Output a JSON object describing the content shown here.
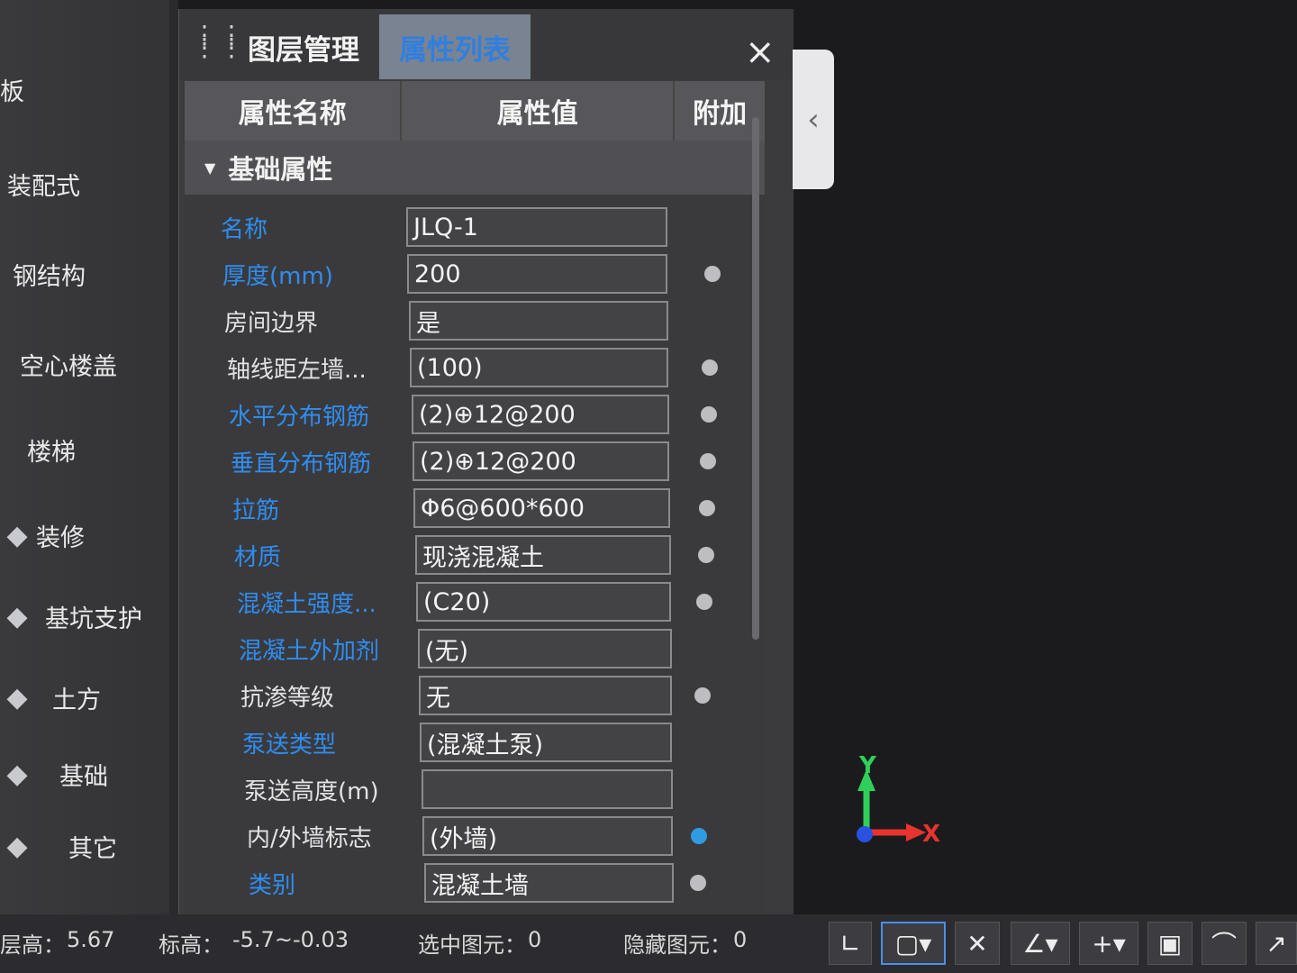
{
  "sidebar": {
    "items": [
      {
        "label": "板",
        "icon": "slab-icon"
      },
      {
        "label": "装配式",
        "icon": "prefab-icon"
      },
      {
        "label": "钢结构",
        "icon": "steel-icon"
      },
      {
        "label": "空心楼盖",
        "icon": "hollow-floor-icon"
      },
      {
        "label": "楼梯",
        "icon": "stairs-icon"
      },
      {
        "label": "装修",
        "icon": "decoration-icon"
      },
      {
        "label": "基坑支护",
        "icon": "pit-support-icon"
      },
      {
        "label": "土方",
        "icon": "earthwork-icon"
      },
      {
        "label": "基础",
        "icon": "foundation-icon"
      },
      {
        "label": "其它",
        "icon": "other-icon"
      }
    ]
  },
  "panel": {
    "tabs": [
      {
        "label": "图层管理",
        "active": false
      },
      {
        "label": "属性列表",
        "active": true
      }
    ],
    "close_label": "×",
    "columns": [
      "属性名称",
      "属性值",
      "附加"
    ],
    "group": {
      "label": "基础属性",
      "expanded": true
    },
    "rows": [
      {
        "name": "名称",
        "value": "JLQ-1",
        "blue": true,
        "dot": "none"
      },
      {
        "name": "厚度(mm)",
        "value": "200",
        "blue": true,
        "dot": "grey"
      },
      {
        "name": "房间边界",
        "value": "是",
        "blue": false,
        "dot": "none"
      },
      {
        "name": "轴线距左墙...",
        "value": "(100)",
        "blue": false,
        "dot": "grey"
      },
      {
        "name": "水平分布钢筋",
        "value": "(2)⊕12@200",
        "blue": true,
        "dot": "grey"
      },
      {
        "name": "垂直分布钢筋",
        "value": "(2)⊕12@200",
        "blue": true,
        "dot": "grey"
      },
      {
        "name": "拉筋",
        "value": "Φ6@600*600",
        "blue": true,
        "dot": "grey"
      },
      {
        "name": "材质",
        "value": "现浇混凝土",
        "blue": true,
        "dot": "grey"
      },
      {
        "name": "混凝土强度...",
        "value": "(C20)",
        "blue": true,
        "dot": "grey"
      },
      {
        "name": "混凝土外加剂",
        "value": "(无)",
        "blue": true,
        "dot": "none"
      },
      {
        "name": "抗渗等级",
        "value": "无",
        "blue": false,
        "dot": "grey"
      },
      {
        "name": "泵送类型",
        "value": "(混凝土泵)",
        "blue": true,
        "dot": "none"
      },
      {
        "name": "泵送高度(m)",
        "value": "",
        "blue": false,
        "dot": "none"
      },
      {
        "name": "内/外墙标志",
        "value": "(外墙)",
        "blue": false,
        "dot": "blue"
      },
      {
        "name": "类别",
        "value": "混凝土墙",
        "blue": true,
        "dot": "grey"
      }
    ]
  },
  "axis": {
    "x_label": "X",
    "y_label": "Y"
  },
  "statusbar": {
    "floor_height_label": "层高：",
    "floor_height_value": "5.67",
    "elevation_label": "标高：",
    "elevation_value": "-5.7~-0.03",
    "selected_label": "选中图元：",
    "selected_value": "0",
    "hidden_label": "隐藏图元：",
    "hidden_value": "0"
  },
  "colors": {
    "accent_blue": "#2f8df0",
    "panel_bg": "#3b3b3e",
    "canvas_bg": "#1b1b1d"
  }
}
